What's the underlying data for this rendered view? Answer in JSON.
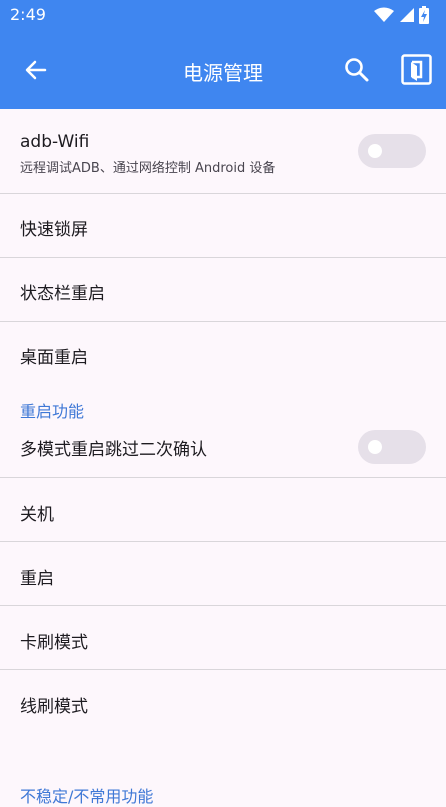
{
  "status_bar": {
    "time": "2:49",
    "icons": [
      "wifi-icon",
      "signal-icon",
      "battery-icon"
    ]
  },
  "app_bar": {
    "title": "电源管理",
    "back_icon": "arrow-left-icon",
    "search_icon": "search-icon",
    "exit_icon": "exit-app-icon"
  },
  "items": {
    "adb_wifi": {
      "label": "adb-Wifi",
      "summary": "远程调试ADB、通过网络控制 Android 设备",
      "enabled": false
    },
    "lock_screen": {
      "label": "快速锁屏"
    },
    "statusbar_restart": {
      "label": "状态栏重启"
    },
    "desktop_restart": {
      "label": "桌面重启"
    }
  },
  "reboot_section": {
    "header": "重启功能",
    "skip_confirm": {
      "label": "多模式重启跳过二次确认",
      "enabled": false
    },
    "shutdown": {
      "label": "关机"
    },
    "reboot": {
      "label": "重启"
    },
    "card_flash": {
      "label": "卡刷模式"
    },
    "wire_flash": {
      "label": "线刷模式"
    }
  },
  "next_section": {
    "header": "不稳定/不常用功能"
  },
  "colors": {
    "primary": "#3f86f0",
    "section_header": "#3f78d6",
    "background": "#fdf7fc"
  }
}
